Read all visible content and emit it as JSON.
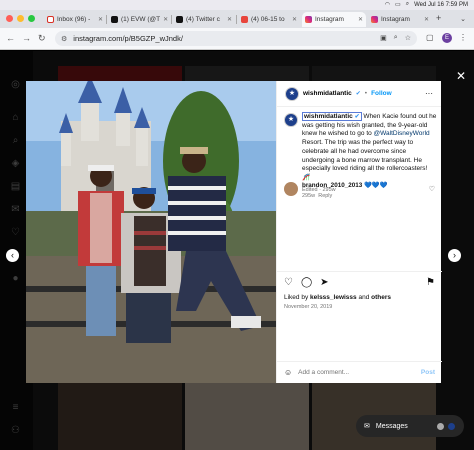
{
  "menubar": {
    "clock": "Wed Jul 16  7:59 PM"
  },
  "tabs": [
    {
      "label": "Inbox (96) -",
      "color": "#d93025"
    },
    {
      "label": "(1) EVW (@T",
      "color": "#111111"
    },
    {
      "label": "(4) Twitter c",
      "color": "#111111"
    },
    {
      "label": "(4) 06-15 to",
      "color": "#e8453c"
    },
    {
      "label": "Instagram",
      "color": "#d6249f"
    },
    {
      "label": "Instagram",
      "color": "#d6249f"
    }
  ],
  "address": {
    "url": "instagram.com/p/B5GZP_wJndk/",
    "profile_initial": "E"
  },
  "post": {
    "username": "wishmidatlantic",
    "follow_label": "Follow",
    "caption_prefix": "When Kacie found out he was getting his wish granted, the 9-year-old knew he wished to go to ",
    "mention": "@WaltDisneyWorld",
    "caption_suffix": " Resort. The trip was the perfect way to celebrate all he had overcome since undergoing a bone marrow transplant. He especially loved riding all the rollercoasters! 🎢",
    "edited_meta": "Edited · 295w",
    "comment_user": "brandon_2010_2013",
    "comment_text": "💙💙💙",
    "comment_age": "295w",
    "reply_label": "Reply",
    "likes_prefix": "Liked by ",
    "likes_user": "kelsss_lewisss",
    "likes_and": " and ",
    "likes_others": "others",
    "date": "November 20, 2019",
    "add_comment_placeholder": "Add a comment...",
    "post_label": "Post"
  },
  "messages": {
    "label": "Messages"
  }
}
